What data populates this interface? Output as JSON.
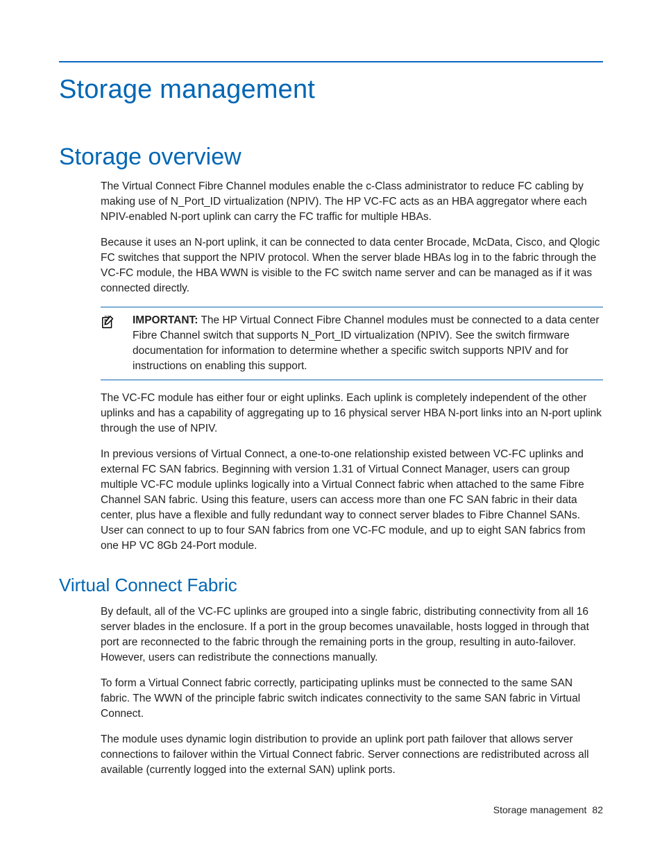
{
  "headings": {
    "h1": "Storage management",
    "h2": "Storage overview",
    "h3": "Virtual Connect Fabric"
  },
  "overview": {
    "p1": "The Virtual Connect Fibre Channel modules enable the c-Class administrator to reduce FC cabling by making use of N_Port_ID virtualization (NPIV). The HP VC-FC acts as an HBA aggregator where each NPIV-enabled N-port uplink can carry the FC traffic for multiple HBAs.",
    "p2": "Because it uses an N-port uplink, it can be connected to data center Brocade, McData, Cisco, and Qlogic FC switches that support the NPIV protocol. When the server blade HBAs log in to the fabric through the VC-FC module, the HBA WWN is visible to the FC switch name server and can be managed as if it was connected directly.",
    "p3": "The VC-FC module has either four or eight uplinks. Each uplink is completely independent of the other uplinks and has a capability of aggregating up to 16 physical server HBA N-port links into an N-port uplink through the use of NPIV.",
    "p4": "In previous versions of Virtual Connect, a one-to-one relationship existed between VC-FC uplinks and external FC SAN fabrics. Beginning with version 1.31 of Virtual Connect Manager, users can group multiple VC-FC module uplinks logically into a Virtual Connect fabric when attached to the same Fibre Channel SAN fabric. Using this feature, users can access more than one FC SAN fabric in their data center, plus have a flexible and fully redundant way to connect server blades to Fibre Channel SANs. User can connect to up to four SAN fabrics from one VC-FC module, and up to eight SAN fabrics from one HP VC 8Gb 24-Port module."
  },
  "callout": {
    "label": "IMPORTANT:",
    "text": " The HP Virtual Connect Fibre Channel modules must be connected to a data center Fibre Channel switch that supports N_Port_ID virtualization (NPIV). See the switch firmware documentation for information to determine whether a specific switch supports NPIV and for instructions on enabling this support."
  },
  "fabric": {
    "p1": "By default, all of the VC-FC uplinks are grouped into a single fabric, distributing connectivity from all 16 server blades in the enclosure. If a port in the group becomes unavailable, hosts logged in through that port are reconnected to the fabric through the remaining ports in the group, resulting in auto-failover. However, users can redistribute the connections manually.",
    "p2": "To form a Virtual Connect fabric correctly, participating uplinks must be connected to the same SAN fabric. The WWN of the principle fabric switch indicates connectivity to the same SAN fabric in Virtual Connect.",
    "p3": "The module uses dynamic login distribution to provide an uplink port path failover that allows server connections to failover within the Virtual Connect fabric. Server connections are redistributed across all available (currently logged into the external SAN) uplink ports."
  },
  "footer": {
    "section": "Storage management",
    "page": "82"
  }
}
